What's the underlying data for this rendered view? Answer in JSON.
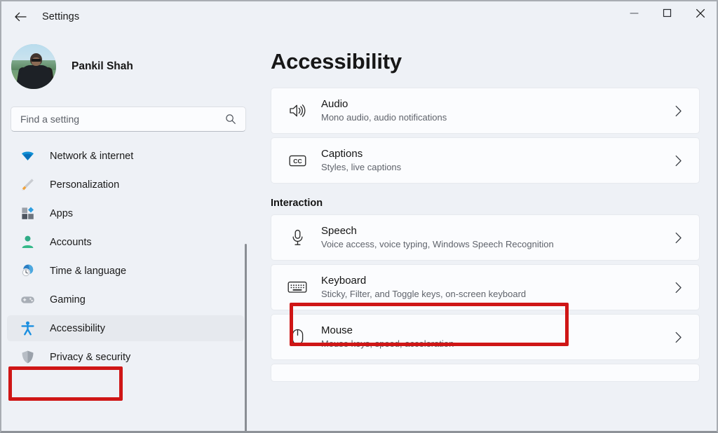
{
  "window": {
    "title": "Settings",
    "back_label": "Back",
    "controls": {
      "minimize": "Minimize",
      "maximize": "Maximize",
      "close": "Close"
    }
  },
  "sidebar": {
    "profile": {
      "name": "Pankil Shah"
    },
    "search": {
      "placeholder": "Find a setting",
      "value": "",
      "icon": "search-icon"
    },
    "items": [
      {
        "label": "Network & internet",
        "icon": "wifi-icon",
        "selected": false
      },
      {
        "label": "Personalization",
        "icon": "paintbrush-icon",
        "selected": false
      },
      {
        "label": "Apps",
        "icon": "apps-grid-icon",
        "selected": false
      },
      {
        "label": "Accounts",
        "icon": "person-icon",
        "selected": false
      },
      {
        "label": "Time & language",
        "icon": "clock-globe-icon",
        "selected": false
      },
      {
        "label": "Gaming",
        "icon": "gamepad-icon",
        "selected": false
      },
      {
        "label": "Accessibility",
        "icon": "accessibility-person-icon",
        "selected": true
      },
      {
        "label": "Privacy & security",
        "icon": "shield-icon",
        "selected": false
      }
    ]
  },
  "main": {
    "heading": "Accessibility",
    "cards_top": [
      {
        "title": "Audio",
        "subtitle": "Mono audio, audio notifications",
        "icon": "speaker-icon",
        "chevron": "chevron-right-icon"
      },
      {
        "title": "Captions",
        "subtitle": "Styles, live captions",
        "icon": "closed-caption-icon",
        "chevron": "chevron-right-icon"
      }
    ],
    "section": {
      "heading": "Interaction",
      "cards": [
        {
          "title": "Speech",
          "subtitle": "Voice access, voice typing, Windows Speech Recognition",
          "icon": "microphone-icon",
          "chevron": "chevron-right-icon"
        },
        {
          "title": "Keyboard",
          "subtitle": "Sticky, Filter, and Toggle keys, on-screen keyboard",
          "icon": "keyboard-icon",
          "chevron": "chevron-right-icon",
          "highlighted": true
        },
        {
          "title": "Mouse",
          "subtitle": "Mouse keys, speed, acceleration",
          "icon": "mouse-icon",
          "chevron": "chevron-right-icon"
        }
      ]
    }
  },
  "annotations": {
    "highlight_color": "#cf1616",
    "boxes": [
      {
        "target": "sidebar-item-accessibility"
      },
      {
        "target": "card-keyboard"
      }
    ]
  },
  "colors": {
    "window_background": "#eef1f6",
    "card_background": "#fbfcfe",
    "selected_nav_background": "#e6e9ee",
    "text_primary": "#141414",
    "text_secondary": "#5f636b",
    "accent_red": "#cf1616"
  }
}
